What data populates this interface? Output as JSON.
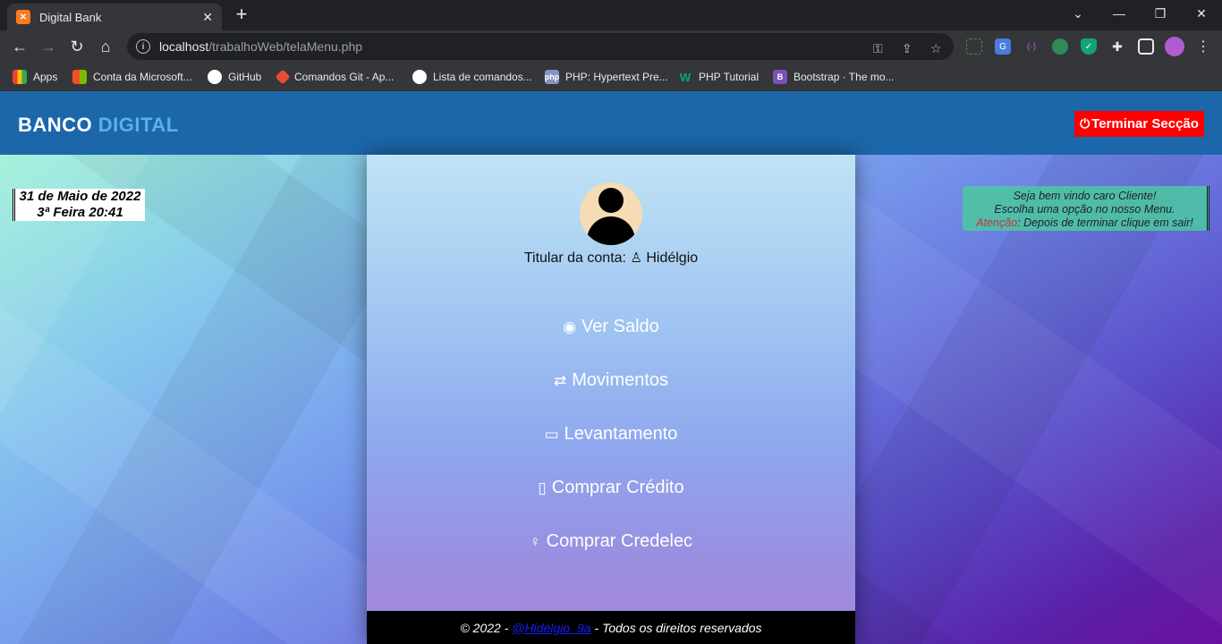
{
  "browser": {
    "tab_title": "Digital Bank",
    "tab_close": "✕",
    "new_tab": "+",
    "url_host": "localhost",
    "url_path": "/trabalhoWeb/telaMenu.php",
    "bookmarks": [
      {
        "label": "Apps",
        "icon": "apps-grid-icon",
        "color": "#ea4335"
      },
      {
        "label": "Conta da Microsoft...",
        "icon": "microsoft-icon",
        "color": "#f25022"
      },
      {
        "label": "GitHub",
        "icon": "github-icon",
        "color": "#ffffff"
      },
      {
        "label": "Comandos Git - Ap...",
        "icon": "git-icon",
        "color": "#e84d31"
      },
      {
        "label": "Lista de comandos...",
        "icon": "globe-icon",
        "color": "#ffffff"
      },
      {
        "label": "PHP: Hypertext Pre...",
        "icon": "php-icon",
        "color": "#8892bf"
      },
      {
        "label": "PHP Tutorial",
        "icon": "w3schools-icon",
        "color": "#04aa6d"
      },
      {
        "label": "Bootstrap · The mo...",
        "icon": "bootstrap-icon",
        "color": "#7952b3"
      }
    ]
  },
  "header": {
    "brand_main": "BANCO ",
    "brand_accent": "DIGITAL",
    "logout_label": "Terminar Secção",
    "brand_color": "#1c66aa",
    "accent_color": "#5ab0ee",
    "logout_color": "#ff0000"
  },
  "date": {
    "line1": "31 de Maio de 2022",
    "line2": "3ª Feira 20:41"
  },
  "welcome": {
    "line1": "Seja bem vindo caro Cliente!",
    "line2": "Escolha uma opção no nosso Menu.",
    "warn": "Atenção",
    "line3": ": Depois de terminar clique em sair!"
  },
  "account": {
    "holder_label": "Titular da conta:",
    "holder_name": "Hidélgio"
  },
  "menu": [
    {
      "label": "Ver Saldo",
      "icon": "eye-icon"
    },
    {
      "label": "Movimentos",
      "icon": "transfer-arrows-icon"
    },
    {
      "label": "Levantamento",
      "icon": "credit-card-icon"
    },
    {
      "label": "Comprar Crédito",
      "icon": "phone-icon"
    },
    {
      "label": "Comprar Credelec",
      "icon": "lightbulb-icon"
    }
  ],
  "footer": {
    "prefix": "© 2022 -",
    "handle": "@Hidélgio_9a",
    "suffix": "- Todos os direitos reservados"
  }
}
